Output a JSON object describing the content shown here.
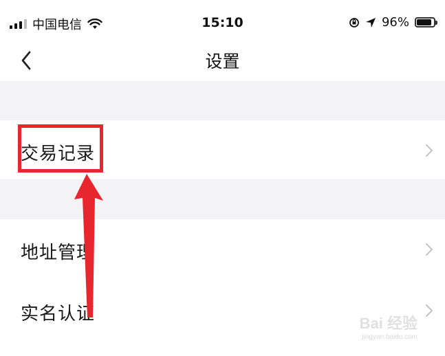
{
  "status_bar": {
    "carrier": "中国电信",
    "time": "15:10",
    "battery_percent": "96%",
    "battery_level": 0.96,
    "icons": [
      "signal-icon",
      "wifi-icon",
      "orientation-lock-icon",
      "location-icon",
      "battery-icon"
    ]
  },
  "nav": {
    "title": "设置",
    "back_icon": "chevron-left-icon"
  },
  "sections": [
    {
      "items": [
        {
          "label": "交易记录",
          "icon": "chevron-right-icon"
        }
      ]
    },
    {
      "items": [
        {
          "label": "地址管理",
          "icon": "chevron-right-icon"
        },
        {
          "label": "实名认证",
          "icon": "chevron-right-icon"
        }
      ]
    }
  ],
  "annotation": {
    "color": "#e8262e"
  },
  "watermark": {
    "logo": "Bai 经验",
    "url": "jingyan.baidu.com"
  }
}
